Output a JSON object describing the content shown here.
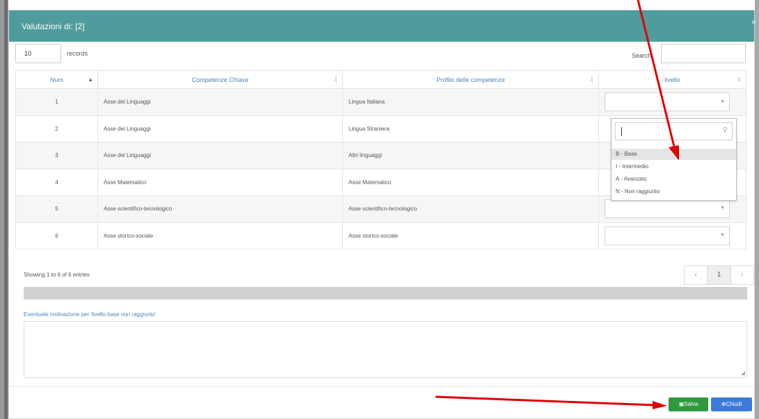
{
  "modal": {
    "title": "Valutazioni di: [2]",
    "close_glyph": "×"
  },
  "records": {
    "value": "10",
    "label": "records"
  },
  "search": {
    "label": "Search:",
    "placeholder": ""
  },
  "table": {
    "headers": [
      "Num",
      "Competenze Chiave",
      "Profilo delle competenze",
      "livello"
    ],
    "rows": [
      {
        "num": "1",
        "competenza": "Asse dei Linguaggi",
        "profilo": "Lingua Italiana"
      },
      {
        "num": "2",
        "competenza": "Asse dei Linguaggi",
        "profilo": "Lingua Straniera"
      },
      {
        "num": "3",
        "competenza": "Asse dei Linguaggi",
        "profilo": "Altri linguaggi"
      },
      {
        "num": "4",
        "competenza": "Asse Matematico",
        "profilo": "Asse Matematico"
      },
      {
        "num": "5",
        "competenza": "Asse scientifico-tecnologico",
        "profilo": "Asse scientifico-tecnologico"
      },
      {
        "num": "6",
        "competenza": "Asse storico-sociale",
        "profilo": "Asse storico-sociale"
      }
    ]
  },
  "dropdown": {
    "options": [
      "B - Base",
      "I - Intermedio",
      "A - Avanzato",
      "N - Non raggiunto"
    ],
    "highlighted": "B - Base"
  },
  "pagination": {
    "info": "Showing 1 to 6 of 6 entries",
    "prev": "‹",
    "current": "1",
    "next": "›"
  },
  "motivation": {
    "label": "Eventuale motivazione per 'livello base non raggiunto'",
    "value": ""
  },
  "buttons": {
    "save": "Salva",
    "close": "Chiudi"
  },
  "icons": {
    "sort": "sort-icon",
    "search": "search-icon",
    "save": "save-icon",
    "close": "close-circle-icon"
  },
  "colors": {
    "header": "#4e9c9c",
    "save_button": "#2f9a3d",
    "close_button": "#3c7bd9",
    "annotation_arrow": "#e00000",
    "link_text": "#4f86b8"
  }
}
